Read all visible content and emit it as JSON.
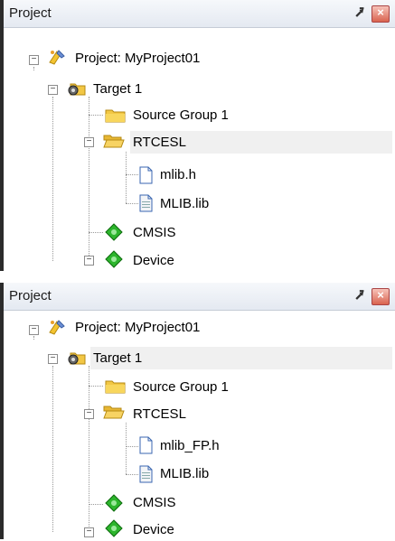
{
  "panels": [
    {
      "title": "Project",
      "pin_glyph": "⭷",
      "close_glyph": "×",
      "tree": {
        "project": "Project: MyProject01",
        "target": "Target 1",
        "source_group": "Source Group 1",
        "rtcesl": "RTCESL",
        "file_header": "mlib.h",
        "file_lib": "MLIB.lib",
        "cmsis": "CMSIS",
        "device": "Device"
      }
    },
    {
      "title": "Project",
      "pin_glyph": "⭷",
      "close_glyph": "×",
      "tree": {
        "project": "Project: MyProject01",
        "target": "Target 1",
        "source_group": "Source Group 1",
        "rtcesl": "RTCESL",
        "file_header": "mlib_FP.h",
        "file_lib": "MLIB.lib",
        "cmsis": "CMSIS",
        "device": "Device"
      }
    }
  ],
  "icons": {
    "project": "project-icon",
    "target": "target-icon",
    "folder_closed": "folder-icon",
    "folder_open": "open-folder-icon",
    "header_file": "header-file-icon",
    "lib_file": "library-file-icon",
    "component": "software-component-icon"
  },
  "colors": {
    "selection": "#f0f0f0",
    "folder": "#f2c744",
    "component": "#2db52d",
    "titlebar": "#e4e9f1",
    "close": "#d9634f"
  }
}
